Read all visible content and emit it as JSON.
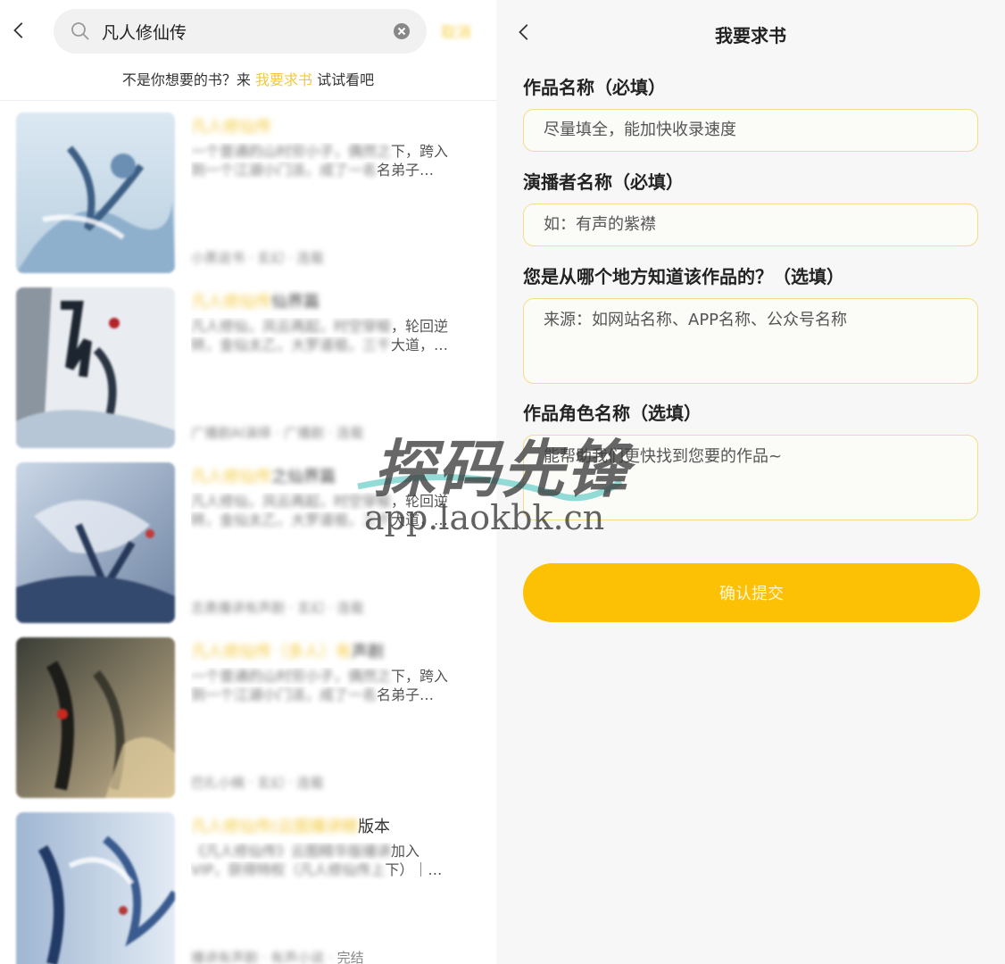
{
  "search": {
    "query": "凡人修仙传",
    "cancel_label": "取消"
  },
  "suggest": {
    "prefix": "不是你想要的书？来 ",
    "link": "我要求书",
    "suffix": " 试试看吧"
  },
  "books": [
    {
      "title_blur": "凡人修仙传",
      "title_sharp": "",
      "desc1_blur": "一个普通的山村穷小子，偶然之",
      "desc1_sharp": "下，跨入",
      "desc2_blur": "到一个江湖小门派，成了一名",
      "desc2_sharp": "名弟子…",
      "meta_blur": "小黑说书 · 玄幻 · 连载",
      "meta_sharp": ""
    },
    {
      "title_blur": "凡人修仙传",
      "title_sharp": "仙界篇",
      "desc1_blur": "凡人修仙，风云再起，时空穿梭",
      "desc1_sharp": "，轮回逆",
      "desc2_blur": "转，金仙太乙，大罗道祖，三千",
      "desc2_sharp": "大道，…",
      "meta_blur": "广播剧AI演绎 · 广播剧 · 连载",
      "meta_sharp": ""
    },
    {
      "title_blur": "凡人修仙传",
      "title_sharp": "之仙界篇",
      "desc1_blur": "凡人修仙，风云再起，时空穿梭",
      "desc1_sharp": "，轮回逆",
      "desc2_blur": "转，金仙太乙，大罗道祖，三千",
      "desc2_sharp": "大道，…",
      "meta_blur": "志勇播讲有声剧 · 玄幻 · 连载",
      "meta_sharp": ""
    },
    {
      "title_blur": "凡人修仙传（多人）有",
      "title_sharp": "声剧",
      "desc1_blur": "一个普通的山村穷小子，偶然之",
      "desc1_sharp": "下，跨入",
      "desc2_blur": "到一个江湖小门派，成了一名",
      "desc2_sharp": "名弟子…",
      "meta_blur": "巴扎小楠 · 玄幻 · 连载",
      "meta_sharp": ""
    },
    {
      "title_blur": "凡人修仙传(云图播讲精",
      "title_sharp": "版本",
      "desc1_blur": "《凡人修仙传》云图精华版播讲",
      "desc1_sharp": "加入",
      "desc2_blur": "VIP，获得特权（凡人修仙传上",
      "desc2_sharp": "下）｜…",
      "meta_blur": "播讲有声剧 · 有声小说 · ",
      "meta_sharp": "完结"
    }
  ],
  "form": {
    "title": "我要求书",
    "fields": [
      {
        "label": "作品名称（必填）",
        "placeholder": "尽量填全，能加快收录速度"
      },
      {
        "label": "演播者名称（必填）",
        "placeholder": "如：有声的紫襟"
      },
      {
        "label": "您是从哪个地方知道该作品的？（选填）",
        "placeholder": "来源：如网站名称、APP名称、公众号名称"
      },
      {
        "label": "作品角色名称（选填）",
        "placeholder": "能帮助我们更快找到您要的作品~"
      }
    ],
    "submit_label": "确认提交"
  },
  "watermark": {
    "main": "探码先锋",
    "sub": "app.laokbk.cn"
  },
  "colors": {
    "accent": "#fcc105",
    "link": "#f3c93a",
    "input_border": "#f4dc8a"
  }
}
